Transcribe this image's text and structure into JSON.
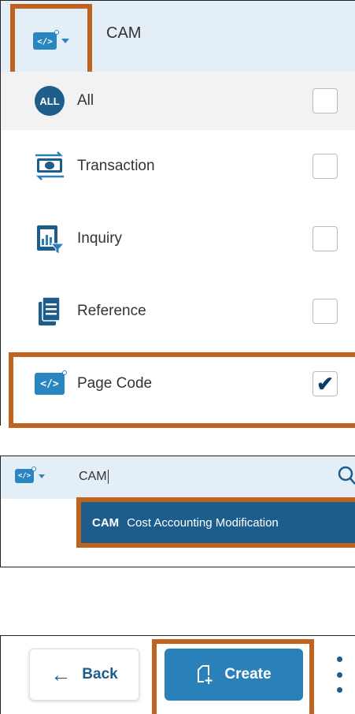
{
  "filter_panel": {
    "query": "CAM",
    "items": [
      {
        "label": "All",
        "icon": "all-badge-icon",
        "badge": "ALL",
        "checked": false
      },
      {
        "label": "Transaction",
        "icon": "transaction-icon",
        "checked": false
      },
      {
        "label": "Inquiry",
        "icon": "inquiry-icon",
        "checked": false
      },
      {
        "label": "Reference",
        "icon": "reference-icon",
        "checked": false
      },
      {
        "label": "Page Code",
        "icon": "page-code-icon",
        "checked": true
      }
    ]
  },
  "search_panel": {
    "query": "CAM",
    "result": {
      "code": "CAM",
      "description": "Cost Accounting Modification"
    }
  },
  "action_bar": {
    "back_label": "Back",
    "create_label": "Create"
  },
  "colors": {
    "accent": "#2a80b9",
    "dark_accent": "#1c5d8c",
    "highlight": "#c0631f",
    "header_bg": "#e3eef6"
  }
}
